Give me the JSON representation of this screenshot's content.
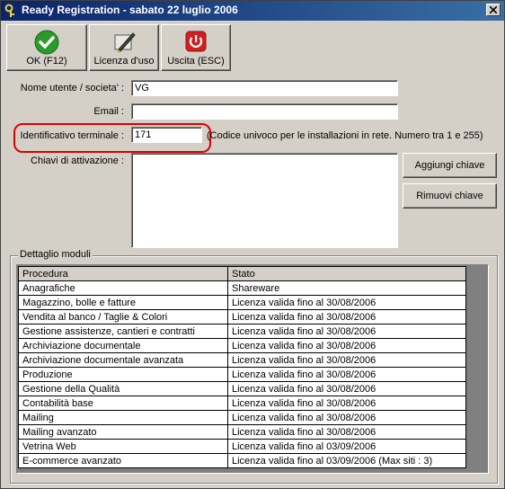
{
  "window": {
    "title": "Ready Registration - sabato 22 luglio 2006"
  },
  "toolbar": {
    "ok_label": "OK (F12)",
    "license_label": "Licenza d'uso",
    "exit_label": "Uscita (ESC)"
  },
  "form": {
    "user_label": "Nome utente / societa' :",
    "user_value": "VG",
    "email_label": "Email :",
    "email_value": "",
    "terminal_label": "Identificativo terminale :",
    "terminal_value": "171",
    "terminal_hint": "(Codice univoco per le installazioni in rete. Numero tra 1 e 255)",
    "keys_label": "Chiavi di attivazione :",
    "add_key_label": "Aggiungi chiave",
    "remove_key_label": "Rimuovi chiave"
  },
  "modules": {
    "group_label": "Dettaglio moduli",
    "columns": [
      "Procedura",
      "Stato"
    ],
    "rows": [
      [
        "Anagrafiche",
        "Shareware"
      ],
      [
        "Magazzino, bolle e fatture",
        "Licenza valida fino al 30/08/2006"
      ],
      [
        "Vendita al banco / Taglie & Colori",
        "Licenza valida fino al 30/08/2006"
      ],
      [
        "Gestione assistenze, cantieri e contratti",
        "Licenza valida fino al 30/08/2006"
      ],
      [
        "Archiviazione documentale",
        "Licenza valida fino al 30/08/2006"
      ],
      [
        "Archiviazione documentale avanzata",
        "Licenza valida fino al 30/08/2006"
      ],
      [
        "Produzione",
        "Licenza valida fino al 30/08/2006"
      ],
      [
        "Gestione della Qualità",
        "Licenza valida fino al 30/08/2006"
      ],
      [
        "Contabilità base",
        "Licenza valida fino al 30/08/2006"
      ],
      [
        "Mailing",
        "Licenza valida fino al 30/08/2006"
      ],
      [
        "Mailing avanzato",
        "Licenza valida fino al 30/08/2006"
      ],
      [
        "Vetrina Web",
        "Licenza valida fino al 03/09/2006"
      ],
      [
        "E-commerce avanzato",
        "Licenza valida fino al 03/09/2006 (Max siti : 3)"
      ]
    ]
  },
  "icons": {
    "ok": "check-icon",
    "license": "pen-certificate-icon",
    "exit": "power-icon",
    "app": "key-icon",
    "close": "close-icon"
  },
  "colors": {
    "title_bar": "#0a246a",
    "ok_green": "#2a9a2a",
    "exit_red": "#d02020",
    "highlight": "#e00000"
  }
}
